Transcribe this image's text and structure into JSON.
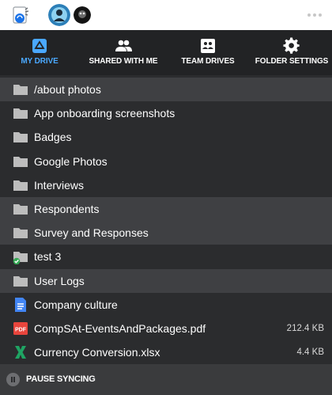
{
  "header": {
    "logo_icon": "sync-client-logo-icon",
    "avatars": [
      "user-avatar-1",
      "user-avatar-2"
    ],
    "more_icon": "more-horizontal-icon"
  },
  "tabs": [
    {
      "label": "MY DRIVE",
      "icon": "drive-icon",
      "active": true
    },
    {
      "label": "SHARED WITH ME",
      "icon": "people-icon",
      "active": false
    },
    {
      "label": "TEAM DRIVES",
      "icon": "team-drive-icon",
      "active": false
    },
    {
      "label": "FOLDER SETTINGS",
      "icon": "gear-icon",
      "active": false
    }
  ],
  "items": [
    {
      "name": "/about photos",
      "type": "folder",
      "size": "",
      "synced": false
    },
    {
      "name": "App onboarding screenshots",
      "type": "folder",
      "size": "",
      "synced": false
    },
    {
      "name": "Badges",
      "type": "folder",
      "size": "",
      "synced": false
    },
    {
      "name": "Google Photos",
      "type": "folder",
      "size": "",
      "synced": false
    },
    {
      "name": "Interviews",
      "type": "folder",
      "size": "",
      "synced": false
    },
    {
      "name": "Respondents",
      "type": "folder",
      "size": "",
      "synced": false
    },
    {
      "name": "Survey and Responses",
      "type": "folder",
      "size": "",
      "synced": false
    },
    {
      "name": "test 3",
      "type": "folder",
      "size": "",
      "synced": true
    },
    {
      "name": "User Logs",
      "type": "folder",
      "size": "",
      "synced": false
    },
    {
      "name": "Company culture",
      "type": "doc",
      "size": "",
      "synced": false
    },
    {
      "name": "CompSAt-EventsAndPackages.pdf",
      "type": "pdf",
      "size": "212.4 KB",
      "synced": false
    },
    {
      "name": "Currency Conversion.xlsx",
      "type": "xlsx",
      "size": "4.4 KB",
      "synced": false
    }
  ],
  "footer": {
    "pause_label": "PAUSE SYNCING"
  },
  "colors": {
    "accent": "#4aa8ff",
    "background": "#2b2c2e",
    "row_highlight": "#3f4043",
    "folder": "#bdbdbd",
    "synced_check": "#34a853",
    "doc": "#4285f4",
    "pdf": "#e8453c",
    "xlsx": "#1fa463"
  }
}
